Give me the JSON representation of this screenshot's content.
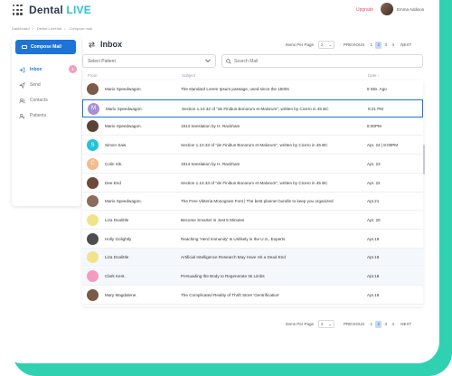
{
  "app": {
    "logo_main": "Dental",
    "logo_accent": "LIVE"
  },
  "header": {
    "upgrade": "Upgrade",
    "user_name": "Emma Addison"
  },
  "breadcrumb": [
    "Dashboard",
    "Dental LiveHub",
    "Compose mail"
  ],
  "sidebar": {
    "compose_label": "Compose Mail",
    "items": [
      {
        "label": "Inbox",
        "badge": "1"
      },
      {
        "label": "Send"
      },
      {
        "label": "Contacts"
      },
      {
        "label": "Patients"
      }
    ]
  },
  "main": {
    "title": "Inbox",
    "pager": {
      "items_per_page_label": "Items Per Page",
      "per_page_value": "2",
      "prev": "PREVIOUS",
      "pages": [
        "1",
        "2",
        "3",
        "4"
      ],
      "active_page": "2",
      "next": "NEXT"
    },
    "filters": {
      "select_placeholder": "Select Patient",
      "search_placeholder": "Search Mail"
    },
    "columns": {
      "from": "From",
      "subject": "Subject",
      "date": "Date"
    }
  },
  "mails": [
    {
      "from": "Mario Speedwagon.",
      "subject": "The standard Lorem Ipsum passage, used since the 1500s",
      "date": "8 Min. Ago",
      "avatar_color": "#7a5a48"
    },
    {
      "from": "Mario Speedwagon.",
      "subject": "Section 1.10.32 of \"de Finibus Bonorum et Malorum\", written by Cicero in 45 BC",
      "date": "9:21 PM",
      "avatar_color": "#a88fd8",
      "avatar_letter": "M"
    },
    {
      "from": "Mario Speedwagon.",
      "subject": "1914 translation by H. Rackham",
      "date": "8:00PM",
      "avatar_color": "#5b4236"
    },
    {
      "from": "Simon Sais.",
      "subject": "Section 1.10.33 of \"de Finibus Bonorum et Malorum\", written by Cicero in 45 BC",
      "date": "Apr. 24 | 8:00PM",
      "avatar_color": "#20c4d8",
      "avatar_letter": "S"
    },
    {
      "from": "Colin Sik.",
      "subject": "1914 translation by H. Rackham",
      "date": "Apr. 23",
      "avatar_color": "#f5b98c",
      "avatar_letter": "C"
    },
    {
      "from": "Dee End",
      "subject": "Section 1.10.33 of \"de Finibus Bonorum et Malorum\", written by Cicero in 45 BC",
      "date": "Apr. 22",
      "avatar_color": "#6b4a3a"
    },
    {
      "from": "Mario Speedwagon.",
      "subject": "The Free Vikteria Monogram Font | The best planner bundle to keep you organized",
      "date": "Apr.21",
      "avatar_color": "#8c6c5a"
    },
    {
      "from": "Liza Doolittle",
      "subject": "Become Smarter in Just 5 Minutes",
      "date": "Apr. 20",
      "avatar_color": "#f2e38a"
    },
    {
      "from": "Holly Golightly",
      "subject": "Reaching 'Herd Immunity' Is Unlikely in the U.S., Experts",
      "date": "Apr.19",
      "avatar_color": "#4e4e4e"
    },
    {
      "from": "Liza Doolittle",
      "subject": "Artificial Intelligence Research May Have Hit a Dead End",
      "date": "Apr.18",
      "avatar_color": "#f2e38a"
    },
    {
      "from": "Clark Kent.",
      "subject": "Persuading the Body to Regenerate Its Limbs",
      "date": "Apr.18",
      "avatar_color": "#f49cc0"
    },
    {
      "from": "Mary Magdalene.",
      "subject": "The Complicated Reality of Thrift Store 'Gentrification'",
      "date": "Apr.18",
      "avatar_color": "#7a5a48"
    }
  ],
  "colors": {
    "accent": "#1e73d6",
    "brand_teal": "#2fd1b0",
    "badge_pink": "#f49cc0",
    "upgrade_red": "#e0526e"
  }
}
